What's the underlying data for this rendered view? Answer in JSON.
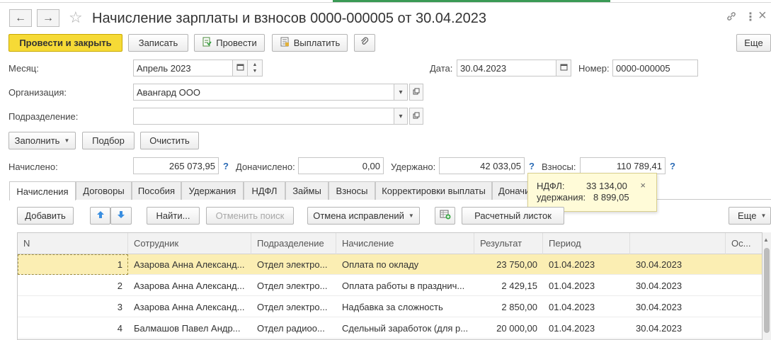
{
  "header": {
    "back_icon": "←",
    "forward_icon": "→",
    "star_icon": "☆",
    "title": "Начисление зарплаты и взносов 0000-000005 от 30.04.2023",
    "link_icon": "🔗",
    "more_icon": "⋮",
    "close_icon": "×"
  },
  "toolbar": {
    "post_close": "Провести и закрыть",
    "save": "Записать",
    "post": "Провести",
    "pay": "Выплатить",
    "attach_icon": "📎",
    "more": "Еще"
  },
  "form": {
    "month_label": "Месяц:",
    "month_value": "Апрель 2023",
    "date_label": "Дата:",
    "date_value": "30.04.2023",
    "number_label": "Номер:",
    "number_value": "0000-000005",
    "org_label": "Организация:",
    "org_value": "Авангард ООО",
    "dept_label": "Подразделение:",
    "dept_value": ""
  },
  "actions": {
    "fill": "Заполнить",
    "select": "Подбор",
    "clear": "Очистить"
  },
  "totals": {
    "accrued_label": "Начислено:",
    "accrued_value": "265 073,95",
    "extra_label": "Доначислено:",
    "extra_value": "0,00",
    "withheld_label": "Удержано:",
    "withheld_value": "42 033,05",
    "contrib_label": "Взносы:",
    "contrib_value": "110 789,41",
    "help": "?"
  },
  "tooltip": {
    "ndfl_label": "НДФЛ:",
    "ndfl_value": "33 134,00",
    "withhold_label": "удержания:",
    "withhold_value": "8 899,05",
    "close": "×"
  },
  "tabs": [
    "Начисления",
    "Договоры",
    "Пособия",
    "Удержания",
    "НДФЛ",
    "Займы",
    "Взносы",
    "Корректировки выплаты",
    "Доначи"
  ],
  "grid_toolbar": {
    "add": "Добавить",
    "up_icon": "🡅",
    "down_icon": "🡇",
    "find": "Найти...",
    "cancel_search": "Отменить поиск",
    "cancel_fix": "Отмена исправлений",
    "payslip": "Расчетный листок",
    "more": "Еще"
  },
  "table": {
    "columns": [
      "N",
      "Сотрудник",
      "Подразделение",
      "Начисление",
      "Результат",
      "Период",
      "",
      "Ос..."
    ],
    "rows": [
      {
        "n": "1",
        "employee": "Азарова Анна Александ...",
        "dept": "Отдел электро...",
        "accrual": "Оплата по окладу",
        "result": "23 750,00",
        "from": "01.04.2023",
        "to": "30.04.2023"
      },
      {
        "n": "2",
        "employee": "Азарова Анна Александ...",
        "dept": "Отдел электро...",
        "accrual": "Оплата работы в празднич...",
        "result": "2 429,15",
        "from": "01.04.2023",
        "to": "30.04.2023"
      },
      {
        "n": "3",
        "employee": "Азарова Анна Александ...",
        "dept": "Отдел электро...",
        "accrual": "Надбавка за сложность",
        "result": "2 850,00",
        "from": "01.04.2023",
        "to": "30.04.2023"
      },
      {
        "n": "4",
        "employee": "Балмашов Павел Андр...",
        "dept": "Отдел радиоо...",
        "accrual": "Сдельный заработок (для р...",
        "result": "20 000,00",
        "from": "01.04.2023",
        "to": "30.04.2023"
      }
    ]
  }
}
